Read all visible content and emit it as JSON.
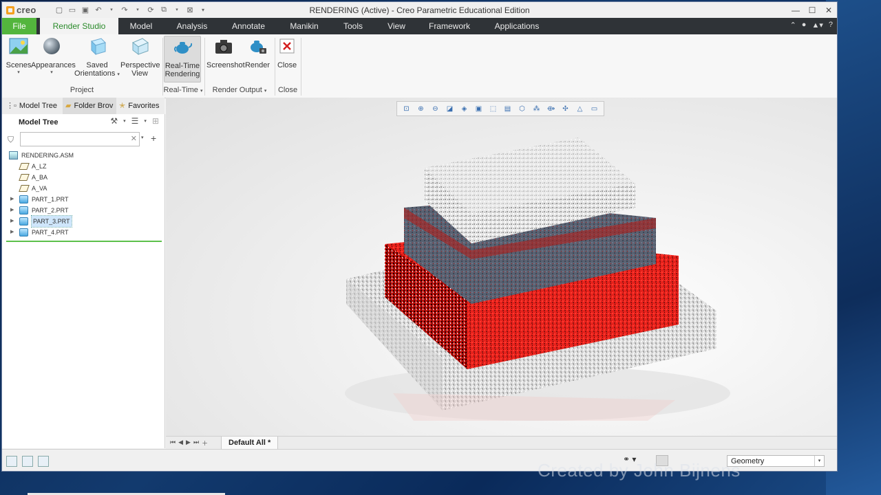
{
  "app": {
    "logo_text": "creo",
    "window_title": "RENDERING (Active) - Creo Parametric Educational Edition"
  },
  "tabs": [
    {
      "label": "File"
    },
    {
      "label": "Render Studio"
    },
    {
      "label": "Model"
    },
    {
      "label": "Analysis"
    },
    {
      "label": "Annotate"
    },
    {
      "label": "Manikin"
    },
    {
      "label": "Tools"
    },
    {
      "label": "View"
    },
    {
      "label": "Framework"
    },
    {
      "label": "Applications"
    }
  ],
  "ribbon": {
    "scenes": "Scenes",
    "appearances": "Appearances",
    "saved_orientations_1": "Saved",
    "saved_orientations_2": "Orientations",
    "perspective_1": "Perspective",
    "perspective_2": "View",
    "realtime_1": "Real-Time",
    "realtime_2": "Rendering",
    "screenshot": "Screenshot",
    "render": "Render",
    "close": "Close",
    "group_project": "Project",
    "group_realtime": "Real-Time",
    "group_render_output": "Render Output",
    "group_close": "Close"
  },
  "panel": {
    "tab_model_tree": "Model Tree",
    "tab_folder_browser": "Folder Brov",
    "tab_favorites": "Favorites",
    "model_tree_heading": "Model Tree",
    "search_value": ""
  },
  "tree": {
    "root": "RENDERING.ASM",
    "items": [
      {
        "label": "A_LZ",
        "type": "datum"
      },
      {
        "label": "A_BA",
        "type": "datum"
      },
      {
        "label": "A_VA",
        "type": "datum"
      },
      {
        "label": "PART_1.PRT",
        "type": "part"
      },
      {
        "label": "PART_2.PRT",
        "type": "part"
      },
      {
        "label": "PART_3.PRT",
        "type": "part",
        "selected": true
      },
      {
        "label": "PART_4.PRT",
        "type": "part"
      }
    ]
  },
  "viewport": {
    "window_tab": "Default All *"
  },
  "status": {
    "filter_value": "Geometry"
  },
  "overlay": {
    "watermark": "Created by John Bijnens"
  },
  "colors": {
    "file_tab": "#53b53d",
    "active_tab_text": "#2a8a2a",
    "tabbar_bg": "#2f3337",
    "render_red": "#e8221c"
  }
}
